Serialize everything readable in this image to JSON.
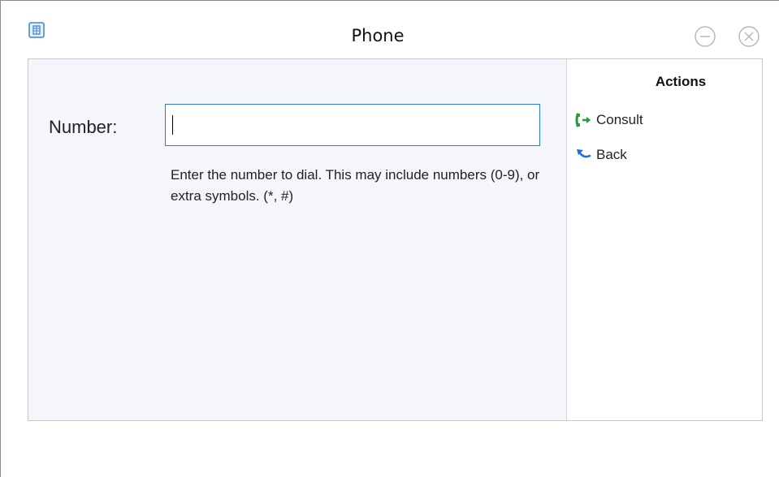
{
  "window": {
    "title": "Phone",
    "app_icon": "phone-app-icon",
    "minimize_icon": "minimize-icon",
    "close_icon": "close-icon"
  },
  "form": {
    "number_label": "Number:",
    "number_value": "",
    "number_placeholder": "",
    "help_text": "Enter the number to dial. This may include numbers (0-9), or extra symbols. (*, #)"
  },
  "actions": {
    "title": "Actions",
    "items": [
      {
        "label": "Consult",
        "icon": "consult-call-icon",
        "icon_color": "#1a9e3a"
      },
      {
        "label": "Back",
        "icon": "back-arrow-icon",
        "icon_color": "#1a6fd8"
      }
    ]
  },
  "colors": {
    "form_background": "#f5f6fc",
    "input_border": "#2a7bd8"
  }
}
